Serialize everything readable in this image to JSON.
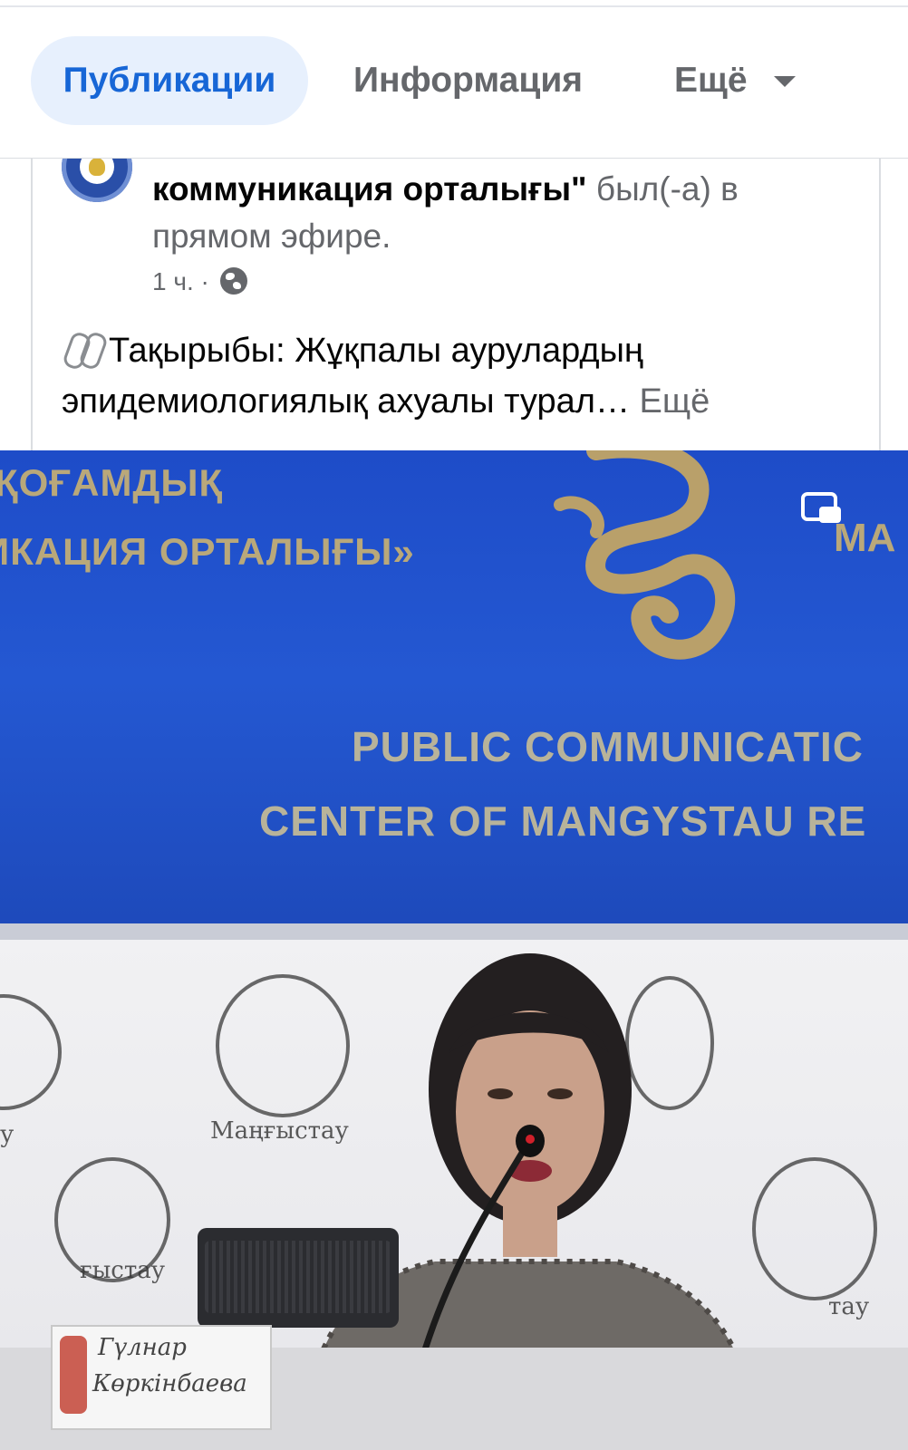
{
  "tabs": {
    "items": [
      {
        "label": "Публикации",
        "active": true
      },
      {
        "label": "Информация",
        "active": false
      },
      {
        "label": "Ещё",
        "active": false
      }
    ]
  },
  "post": {
    "author_name": "коммуникация орталығы\"",
    "live_text": " был(-а) в прямом эфире.",
    "time": "1 ч. ·",
    "icons": [
      "globe-icon",
      "paperclip-icon",
      "caret-down-icon",
      "picture-in-picture-icon"
    ],
    "body_text": "Тақырыбы: Жұқпалы аурулардың эпидемиологиялық ахуалы турал…",
    "more_label": "Ещё"
  },
  "video": {
    "wall_line_1": "ҚОҒАМДЫҚ",
    "wall_line_2": "ИКАЦИЯ ОРТАЛЫҒЫ»",
    "wall_right": "МА",
    "banner_line_1": "PUBLIC COMMUNICATIC",
    "banner_line_2": "CENTER OF MANGYSTAU RE",
    "seal_label": "Маңғыстау",
    "seal_label_left": "у",
    "seal_label_bottom_left": "ғыстау",
    "seal_label_bottom_right": "тау",
    "nameplate_line_1": "Гүлнар",
    "nameplate_line_2": "Көркінбаева"
  },
  "colors": {
    "accent": "#1766d6",
    "active_tab_bg": "#e7f0fd",
    "secondary_text": "#65676b",
    "wall_blue": "#1f4fc4",
    "wall_gold": "#b9a87a"
  }
}
